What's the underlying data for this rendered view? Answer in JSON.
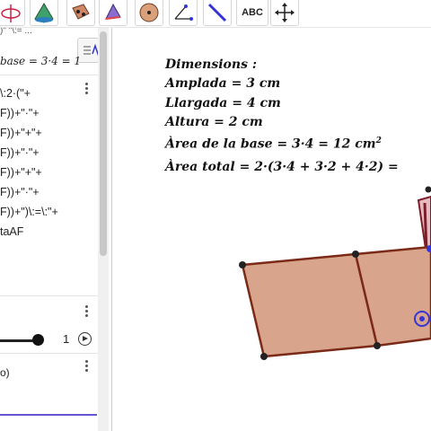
{
  "toolbar": {
    "tools": [
      {
        "name": "rotate-view-tool"
      },
      {
        "name": "pyramid-tool"
      },
      {
        "name": "cube-net-tool"
      },
      {
        "name": "prism-tool"
      },
      {
        "name": "sphere-tool"
      },
      {
        "name": "angle-tool"
      },
      {
        "name": "line-tool"
      },
      {
        "name": "text-tool",
        "label": "ABC"
      },
      {
        "name": "move-graphics-tool"
      }
    ]
  },
  "algebra": {
    "top_fragment": ")\" \"\\:= ...",
    "base_line": "base = 3·4 = 1",
    "code_lines": [
      "\\:2·(\"+",
      "F))+\"·\"+",
      "F))+\"+\"+",
      "F))+\"·\"+",
      "F))+\"+\"+",
      "F))+\"·\"+",
      "F))+\")\\:=\\:\"+",
      "taAF"
    ],
    "slider_value": "1",
    "slider_level": 1.0,
    "p_line": "o)"
  },
  "graphics": {
    "dimensions_title": "Dimensions :",
    "lines": [
      {
        "label": "Amplada",
        "value": "= 3 cm"
      },
      {
        "label": "Llargada",
        "value": "= 4 cm"
      },
      {
        "label": "Altura",
        "value": "= 2 cm"
      },
      {
        "label": "Àrea de la base",
        "value": "= 3·4 = 12 cm",
        "sup": "2"
      },
      {
        "label": "Àrea total",
        "value": "= 2·(3·4 + 3·2 + 4·2) ="
      }
    ]
  },
  "colors": {
    "net_fill": "#d9a48c",
    "net_stroke": "#7a2a16",
    "vertex": "#222222",
    "selected_point": "#3535d6",
    "accent_line": "#6557d2"
  }
}
